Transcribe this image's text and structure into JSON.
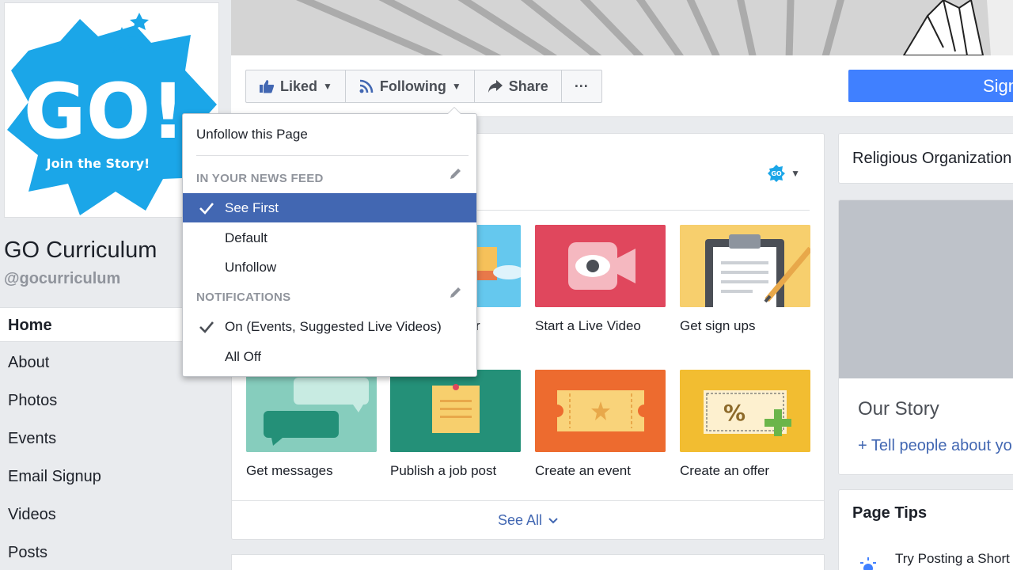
{
  "page": {
    "name": "GO Curriculum",
    "handle": "@gocurriculum",
    "logo_text": "GO!",
    "logo_tagline": "Join the Story!"
  },
  "nav": {
    "items": [
      {
        "label": "Home",
        "active": true
      },
      {
        "label": "About"
      },
      {
        "label": "Photos"
      },
      {
        "label": "Events"
      },
      {
        "label": "Email Signup"
      },
      {
        "label": "Videos"
      },
      {
        "label": "Posts"
      }
    ]
  },
  "actions": {
    "liked": "Liked",
    "following": "Following",
    "share": "Share",
    "more": "···",
    "sign_up": "Sign"
  },
  "dropdown": {
    "unfollow_page": "Unfollow this Page",
    "news_feed_header": "IN YOUR NEWS FEED",
    "news_feed_options": [
      "See First",
      "Default",
      "Unfollow"
    ],
    "news_feed_selected": "See First",
    "notifications_header": "NOTIFICATIONS",
    "notification_options": [
      "On (Events, Suggested Live Videos)",
      "All Off"
    ],
    "notification_selected": "On (Events, Suggested Live Videos)"
  },
  "tiles": {
    "row1_partial_label": "r",
    "live_video": "Start a Live Video",
    "sign_ups": "Get sign ups",
    "messages": "Get messages",
    "job_post": "Publish a job post",
    "event": "Create an event",
    "offer": "Create an offer"
  },
  "see_all": "See All",
  "right": {
    "category": "Religious Organization",
    "story_title": "Our Story",
    "story_link": "+ Tell people about your",
    "tips_title": "Page Tips",
    "tip_text": "Try Posting a Short"
  },
  "colors": {
    "fb_blue": "#4267b2",
    "selected_bg": "#4267b2",
    "sign_up_button": "#4080ff",
    "logo_blue": "#1ba6e8",
    "tile_live": "#e0475d",
    "tile_signups": "#f7cf6d",
    "tile_messages": "#86cdbd",
    "tile_job": "#249078",
    "tile_event": "#ed6b2f",
    "tile_offer": "#f2bd31"
  }
}
